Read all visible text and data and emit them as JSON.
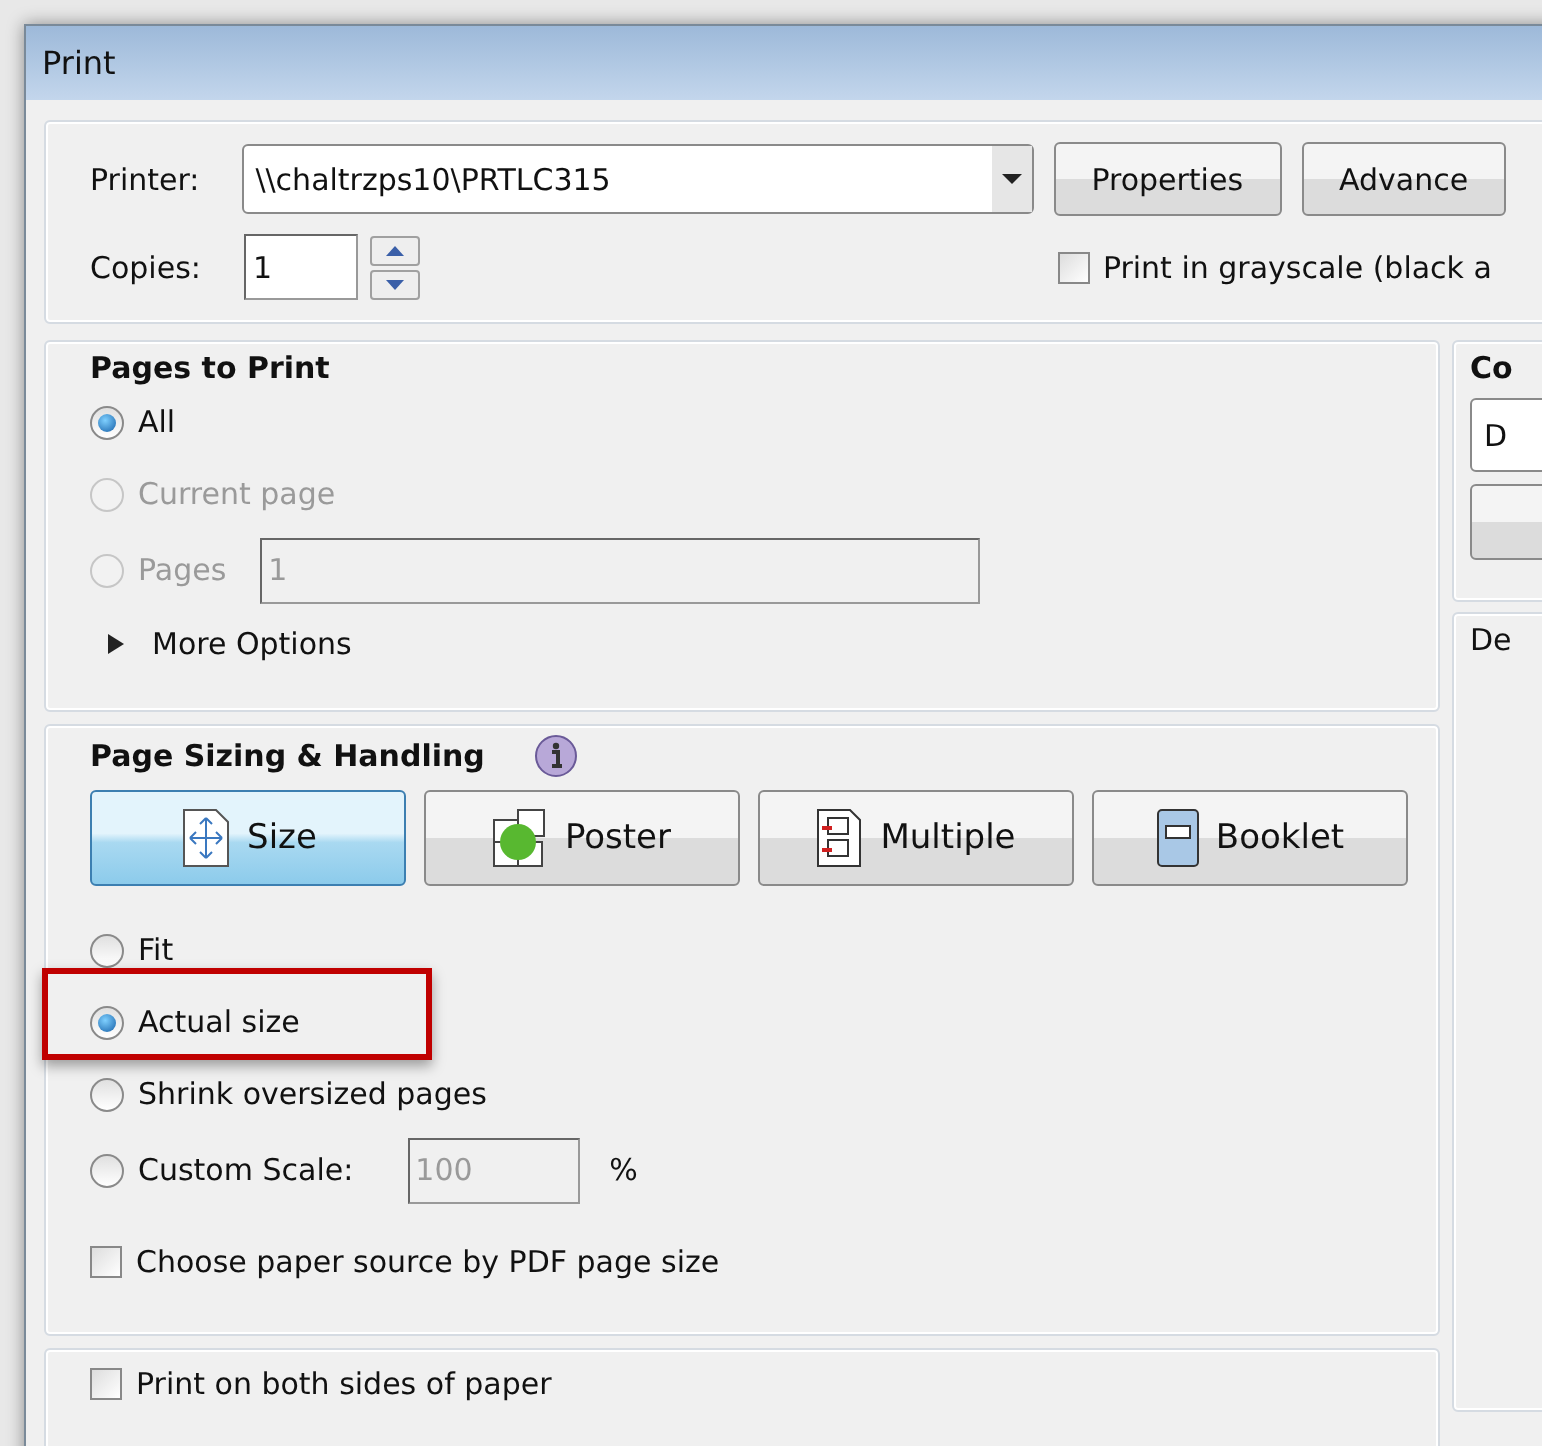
{
  "window": {
    "title": "Print"
  },
  "printer": {
    "label": "Printer:",
    "value": "\\\\chaltrzps10\\PRTLC315",
    "buttons": [
      "Properties",
      "Advance"
    ]
  },
  "copies": {
    "label": "Copies:",
    "value": "1"
  },
  "grayscale": {
    "label": "Print in grayscale (black a",
    "checked": false
  },
  "pages_to_print": {
    "title": "Pages to Print",
    "options": [
      {
        "label": "All",
        "selected": true,
        "disabled": false
      },
      {
        "label": "Current page",
        "selected": false,
        "disabled": true
      },
      {
        "label": "Pages",
        "selected": false,
        "disabled": true
      }
    ],
    "pages_value": "1",
    "more_options": {
      "label": "More Options",
      "expanded": false
    }
  },
  "page_sizing": {
    "title": "Page Sizing & Handling",
    "modes": [
      {
        "label": "Size",
        "kind": "size",
        "selected": true
      },
      {
        "label": "Poster",
        "kind": "poster",
        "selected": false
      },
      {
        "label": "Multiple",
        "kind": "multiple",
        "selected": false
      },
      {
        "label": "Booklet",
        "kind": "booklet",
        "selected": false
      }
    ],
    "options": [
      {
        "label": "Fit",
        "selected": false,
        "highlighted": false
      },
      {
        "label": "Actual size",
        "selected": true,
        "highlighted": true
      },
      {
        "label": "Shrink oversized pages",
        "selected": false,
        "highlighted": false
      },
      {
        "label": "Custom Scale:",
        "selected": false,
        "highlighted": false
      }
    ],
    "scale_value": "100",
    "scale_unit": "%",
    "paper_source": {
      "label": "Choose paper source by PDF page size",
      "checked": false
    }
  },
  "duplex": {
    "label": "Print on both sides of paper",
    "checked": false
  },
  "right_panel": {
    "group_title": "Co",
    "dropdown_value": "D",
    "second_title": "De"
  }
}
